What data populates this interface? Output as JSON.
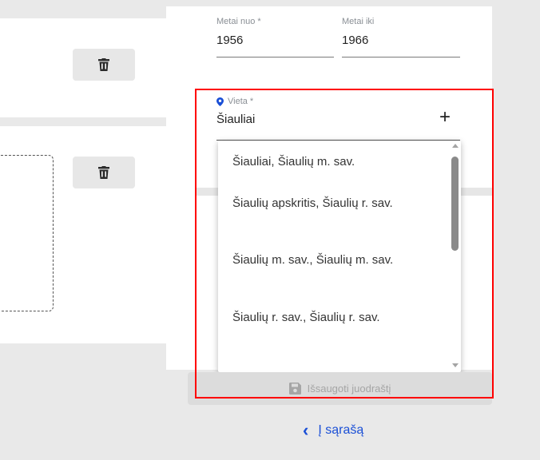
{
  "years": {
    "from": {
      "label": "Metai nuo *",
      "value": "1956"
    },
    "to": {
      "label": "Metai iki",
      "value": "1966"
    }
  },
  "place": {
    "label": "Vieta *",
    "value": "Šiauliai",
    "add_symbol": "+",
    "suggestions": [
      "Šiauliai, Šiaulių m. sav.",
      "Šiaulių apskritis, Šiaulių r. sav.",
      "Šiaulių m. sav., Šiaulių m. sav.",
      "Šiaulių r. sav., Šiaulių r. sav."
    ]
  },
  "actions": {
    "save_draft": "Išsaugoti juodraštį",
    "back_link": "Į sąrašą",
    "back_chevron": "‹"
  },
  "icons": {
    "delete": "trash-icon",
    "pin": "map-pin-icon",
    "save": "floppy-disk-icon"
  },
  "colors": {
    "highlight": "#ff0000",
    "link": "#1a4fd6",
    "pin": "#1a4fd6"
  }
}
